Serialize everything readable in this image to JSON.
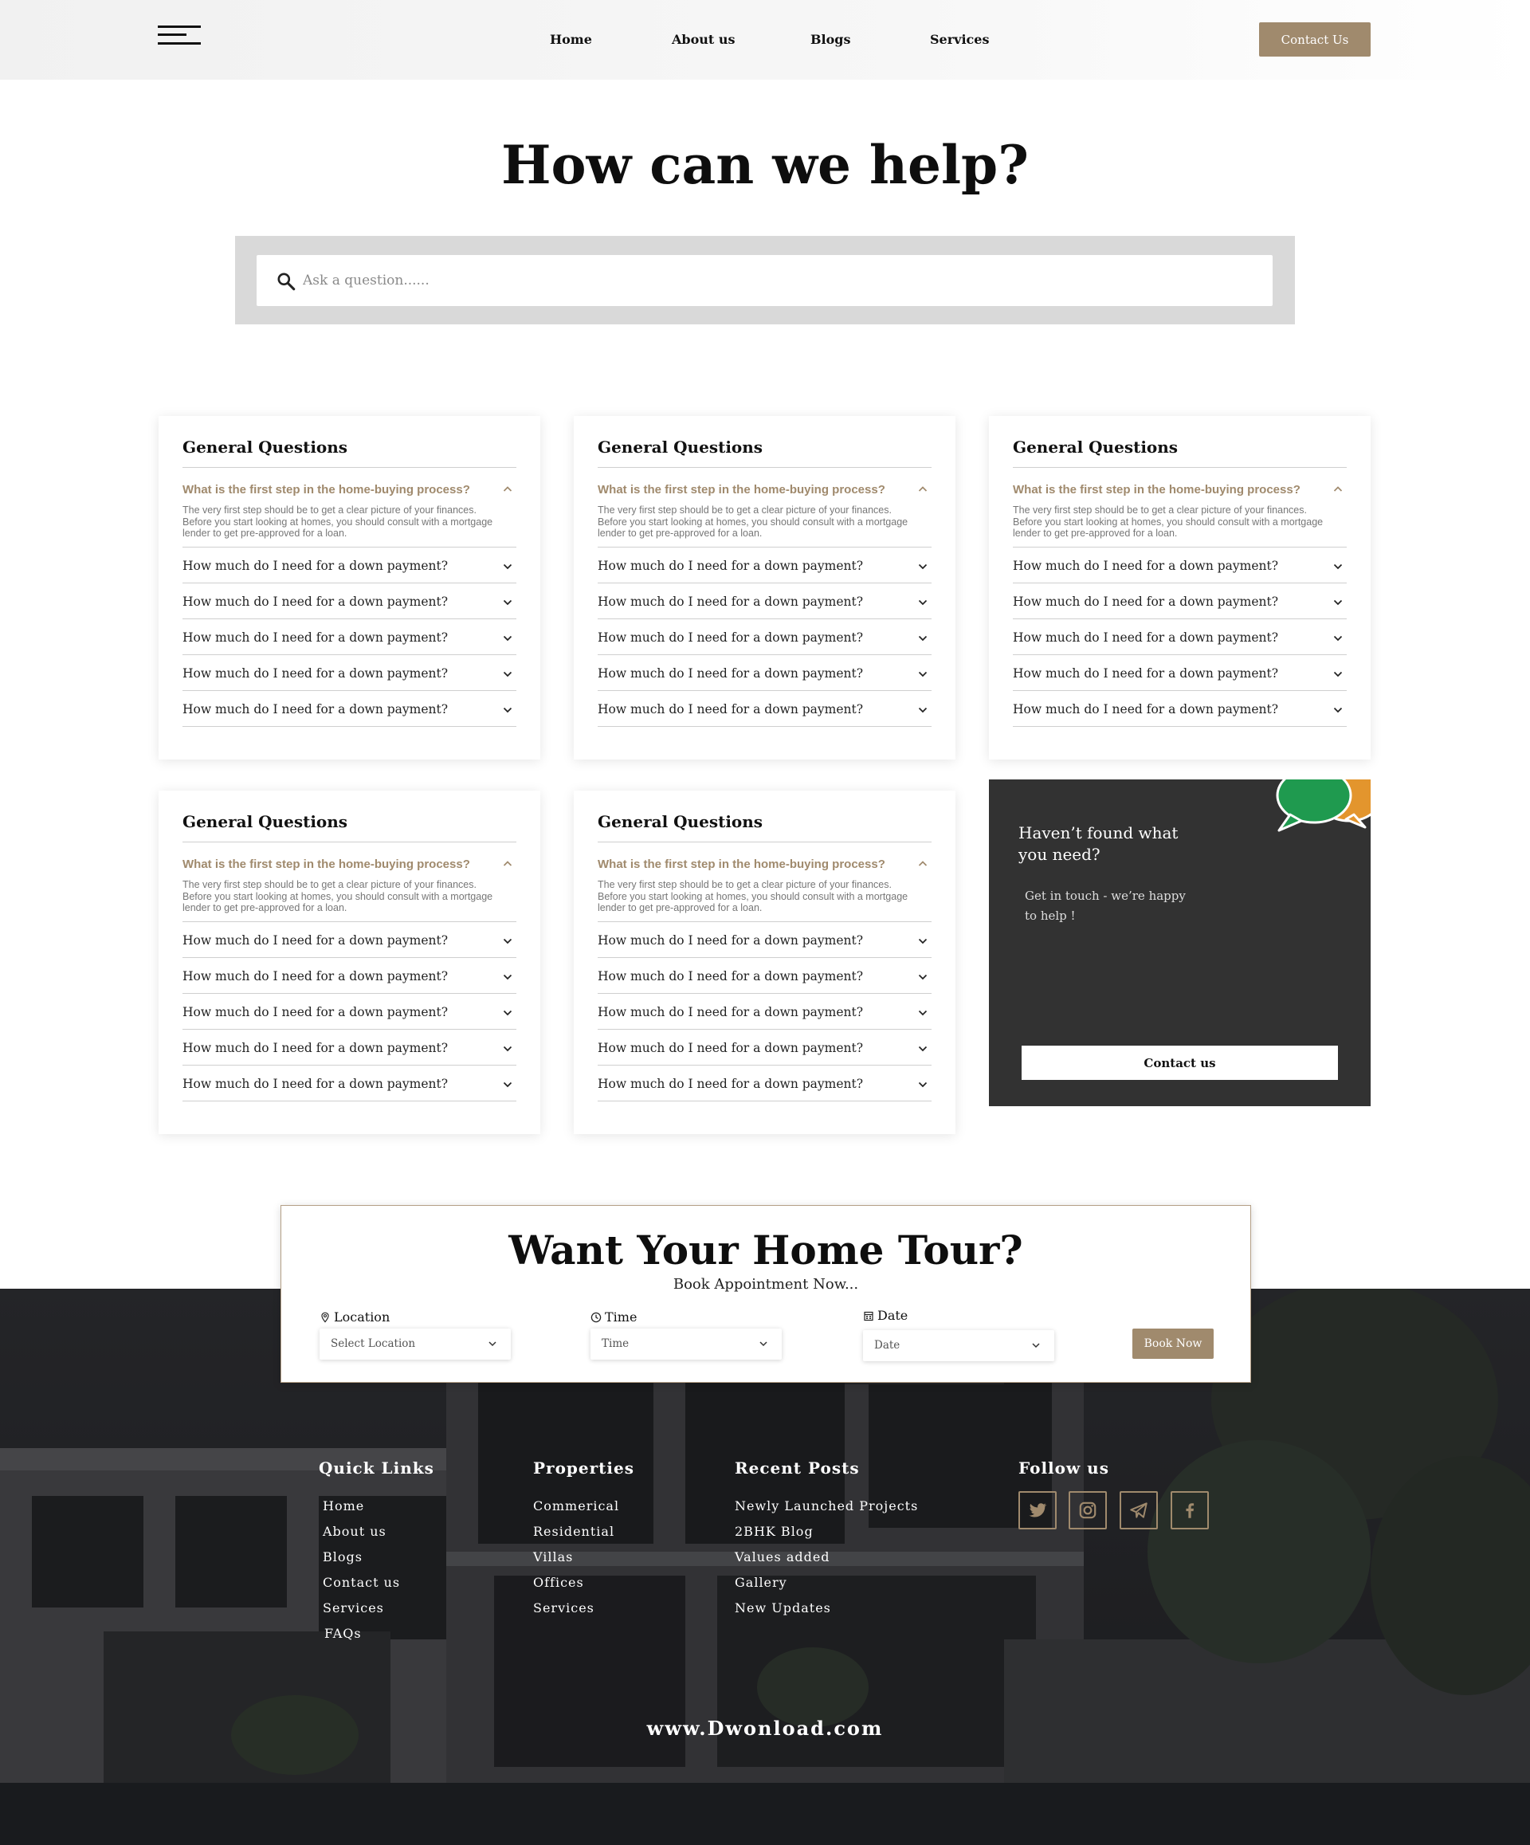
{
  "nav": {
    "links": [
      "Home",
      "About us",
      "Blogs",
      "Services"
    ],
    "contact_label": "Contact Us"
  },
  "hero": {
    "title": "How can we help?",
    "search_placeholder": "Ask a question......"
  },
  "faq_cards": [
    {
      "title": "General Questions",
      "open_question": "What is the first step in the home-buying process?",
      "open_answer": "The very first step should be to get a clear picture of your finances. Before you start looking at homes, you should consult with a mortgage lender to get pre-approved for a loan.",
      "questions": [
        "How much do I need for a down payment?",
        "How much do I need for a down payment?",
        "How much do I need for a down payment?",
        "How much do I need for a down payment?",
        "How much do I need for a down payment?"
      ]
    },
    {
      "title": "General Questions",
      "open_question": "What is the first step in the home-buying process?",
      "open_answer": "The very first step should be to get a clear picture of your finances. Before you start looking at homes, you should consult with a mortgage lender to get pre-approved for a loan.",
      "questions": [
        "How much do I need for a down payment?",
        "How much do I need for a down payment?",
        "How much do I need for a down payment?",
        "How much do I need for a down payment?",
        "How much do I need for a down payment?"
      ]
    },
    {
      "title": "General Questions",
      "open_question": "What is the first step in the home-buying process?",
      "open_answer": "The very first step should be to get a clear picture of your finances. Before you start looking at homes, you should consult with a mortgage lender to get pre-approved for a loan.",
      "questions": [
        "How much do I need for a down payment?",
        "How much do I need for a down payment?",
        "How much do I need for a down payment?",
        "How much do I need for a down payment?",
        "How much do I need for a down payment?"
      ]
    },
    {
      "title": "General Questions",
      "open_question": "What is the first step in the home-buying process?",
      "open_answer": "The very first step should be to get a clear picture of your finances. Before you start looking at homes, you should consult with a mortgage lender to get pre-approved for a loan.",
      "questions": [
        "How much do I need for a down payment?",
        "How much do I need for a down payment?",
        "How much do I need for a down payment?",
        "How much do I need for a down payment?",
        "How much do I need for a down payment?"
      ]
    },
    {
      "title": "General Questions",
      "open_question": "What is the first step in the home-buying process?",
      "open_answer": "The very first step should be to get a clear picture of your finances. Before you start looking at homes, you should consult with a mortgage lender to get pre-approved for a loan.",
      "questions": [
        "How much do I need for a down payment?",
        "How much do I need for a down payment?",
        "How much do I need for a down payment?",
        "How much do I need for a down payment?",
        "How much do I need for a down payment?"
      ]
    }
  ],
  "help_card": {
    "title": "Haven’t found what you need?",
    "subtitle": "Get in touch - we’re happy to help !",
    "button_label": "Contact us"
  },
  "tour": {
    "title": "Want Your Home Tour?",
    "subtitle": "Book Appointment Now...",
    "location_label": "Location",
    "location_value": "Select Location",
    "time_label": "Time",
    "time_value": "Time",
    "date_label": "Date",
    "date_value": "Date",
    "book_label": "Book Now"
  },
  "footer": {
    "quick_links_title": "Quick Links",
    "quick_links": [
      "Home",
      "About us",
      "Blogs",
      "Contact us",
      "Services",
      "FAQs"
    ],
    "properties_title": "Properties",
    "properties": [
      "Commerical",
      "Residential",
      "Villas",
      "Offices",
      "Services"
    ],
    "recent_posts_title": "Recent Posts",
    "recent_posts": [
      "Newly Launched Projects",
      "2BHK Blog",
      "Values added",
      "Gallery",
      "New Updates"
    ],
    "follow_title": "Follow us",
    "social_icons": [
      "twitter-icon",
      "instagram-icon",
      "telegram-icon",
      "facebook-icon"
    ],
    "url": "www.Dwonload.com"
  },
  "colors": {
    "accent": "#a08a6d",
    "dark_card": "#323232",
    "bubble_green": "#1f9a4f",
    "bubble_orange": "#e3952d"
  }
}
